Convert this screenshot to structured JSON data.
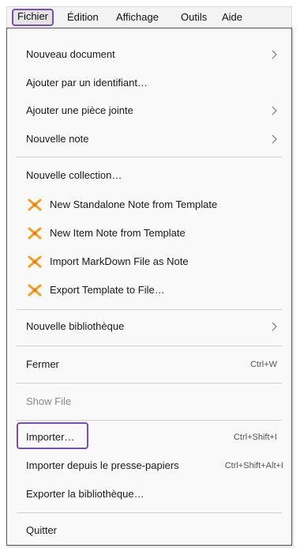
{
  "menubar": {
    "items": [
      "Fichier",
      "Édition",
      "Affichage",
      "Outils",
      "Aide"
    ]
  },
  "menu": {
    "items": [
      {
        "label": "Nouveau document",
        "submenu": true
      },
      {
        "label": "Ajouter par un identifiant…"
      },
      {
        "label": "Ajouter une pièce jointe",
        "submenu": true
      },
      {
        "label": "Nouvelle note",
        "submenu": true
      },
      {
        "label": "Nouvelle collection…"
      },
      {
        "label": "New Standalone Note from Template",
        "icon": "template-plugin-icon"
      },
      {
        "label": "New Item Note from Template",
        "icon": "template-plugin-icon"
      },
      {
        "label": "Import MarkDown File as Note",
        "icon": "template-plugin-icon"
      },
      {
        "label": "Export Template to File…",
        "icon": "template-plugin-icon"
      },
      {
        "label": "Nouvelle bibliothèque",
        "submenu": true
      },
      {
        "label": "Fermer",
        "shortcut": "Ctrl+W"
      },
      {
        "label": "Show File",
        "disabled": true
      },
      {
        "label": "Importer…",
        "shortcut": "Ctrl+Shift+I",
        "highlighted": true
      },
      {
        "label": "Importer depuis le presse-papiers",
        "shortcut": "Ctrl+Shift+Alt+I"
      },
      {
        "label": "Exporter la bibliothèque…"
      },
      {
        "label": "Quitter"
      }
    ]
  },
  "colors": {
    "highlight_border": "#7a4fa6",
    "icon_orange": "#f0a020"
  }
}
